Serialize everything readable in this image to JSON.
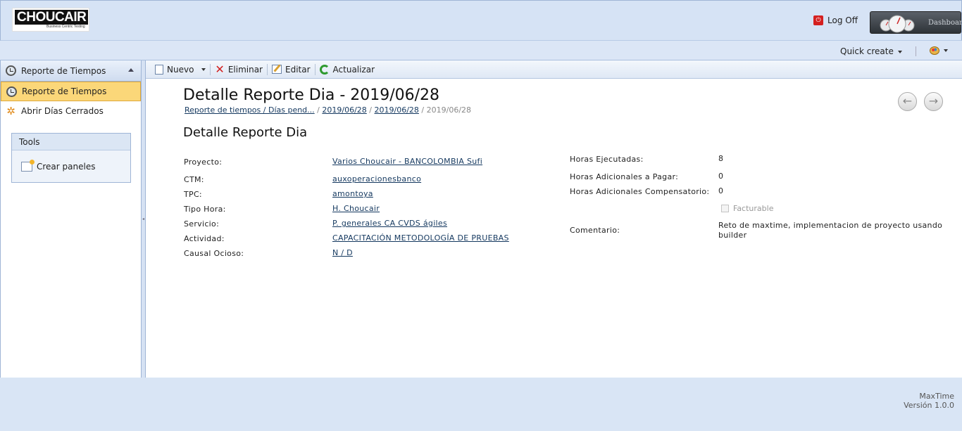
{
  "header": {
    "logo_text": "CHOUCAIR",
    "logo_tagline": "Business Centric Testing",
    "logoff_label": "Log Off",
    "dashboard_label": "Dashboard"
  },
  "topbar": {
    "quick_create_label": "Quick create"
  },
  "sidebar": {
    "header_label": "Reporte de Tiempos",
    "items": [
      {
        "label": "Reporte de Tiempos",
        "active": true
      },
      {
        "label": "Abrir Días Cerrados",
        "active": false
      }
    ],
    "tools": {
      "title": "Tools",
      "items": [
        {
          "label": "Crear paneles"
        }
      ]
    }
  },
  "toolbar": {
    "new_label": "Nuevo",
    "delete_label": "Eliminar",
    "edit_label": "Editar",
    "refresh_label": "Actualizar"
  },
  "page": {
    "title": "Detalle Reporte Dia - 2019/06/28",
    "breadcrumb": [
      "Reporte de tiempos / Días pend...",
      "2019/06/28",
      "2019/06/28",
      "2019/06/28"
    ],
    "breadcrumb_separator": "/",
    "subtitle": "Detalle Reporte Dia"
  },
  "details": {
    "left": [
      {
        "label": "Proyecto:",
        "value": "Varios Choucair - BANCOLOMBIA Sufi"
      },
      {
        "label": "CTM:",
        "value": "auxoperacionesbanco"
      },
      {
        "label": "TPC:",
        "value": "amontoya"
      },
      {
        "label": "Tipo Hora:",
        "value": "H. Choucair"
      },
      {
        "label": "Servicio:",
        "value": "P. generales CA CVDS ágiles"
      },
      {
        "label": "Actividad:",
        "value": "CAPACITACIÓN METODOLOGÍA DE PRUEBAS"
      },
      {
        "label": "Causal Ocioso:",
        "value": "N / D"
      }
    ],
    "right": [
      {
        "label": "Horas Ejecutadas:",
        "value": "8"
      },
      {
        "label": "Horas Adicionales a Pagar:",
        "value": "0"
      },
      {
        "label": "Horas Adicionales Compensatorio:",
        "value": "0"
      }
    ],
    "facturable_label": "Facturable",
    "facturable_checked": false,
    "comment_label": "Comentario:",
    "comment_value": "Reto de maxtime, implementacion de proyecto usando builder"
  },
  "footer": {
    "app_name": "MaxTime",
    "version": "Versión 1.0.0"
  }
}
